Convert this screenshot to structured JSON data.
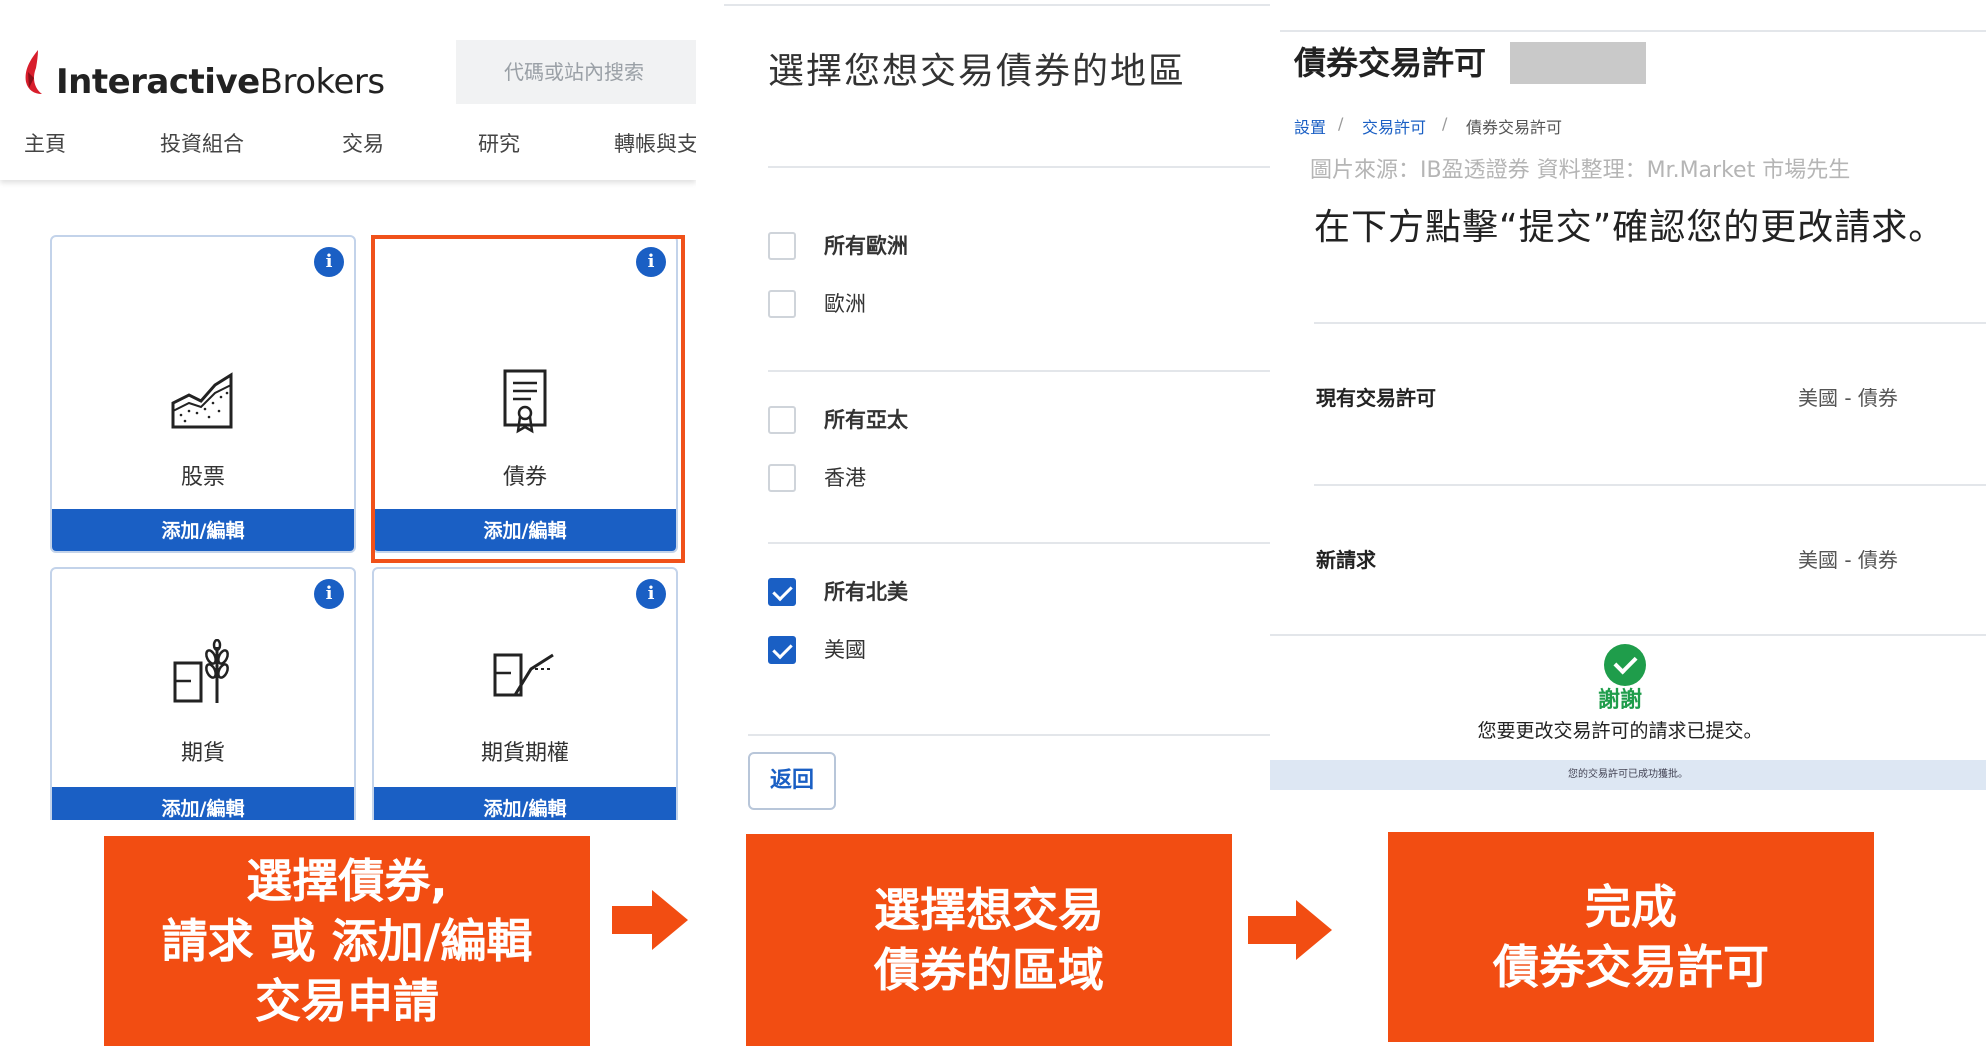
{
  "panel1": {
    "brand": {
      "bold": "Interactive",
      "regular": "Brokers"
    },
    "search": {
      "placeholder": "代碼或站內搜索"
    },
    "nav": [
      "主頁",
      "投資組合",
      "交易",
      "研究",
      "轉帳與支"
    ],
    "info_glyph": "i",
    "cards": [
      {
        "label": "股票",
        "button": "添加/編輯",
        "icon": "stock-chart-icon"
      },
      {
        "label": "債券",
        "button": "添加/編輯",
        "icon": "bond-certificate-icon"
      },
      {
        "label": "期貨",
        "button": "添加/編輯",
        "icon": "futures-wheat-icon"
      },
      {
        "label": "期貨期權",
        "button": "添加/編輯",
        "icon": "futures-options-icon"
      }
    ]
  },
  "panel2": {
    "title": "選擇您想交易債券的地區",
    "groups": [
      {
        "items": [
          {
            "label": "所有歐洲",
            "checked": false,
            "bold": true
          },
          {
            "label": "歐洲",
            "checked": false,
            "bold": false
          }
        ]
      },
      {
        "items": [
          {
            "label": "所有亞太",
            "checked": false,
            "bold": true
          },
          {
            "label": "香港",
            "checked": false,
            "bold": false
          }
        ]
      },
      {
        "items": [
          {
            "label": "所有北美",
            "checked": true,
            "bold": true
          },
          {
            "label": "美國",
            "checked": true,
            "bold": false
          }
        ]
      }
    ],
    "back_button": "返回"
  },
  "panel3": {
    "title": "債券交易許可",
    "breadcrumb": [
      "設置",
      "交易許可",
      "債券交易許可"
    ],
    "breadcrumb_sep": "/",
    "source_note": "圖片來源：IB盈透證券   資料整理：Mr.Market 市場先生",
    "confirm_text": "在下方點擊“提交”確認您的更改請求。",
    "rows": [
      {
        "label": "現有交易許可",
        "value": "美國 - 債券"
      },
      {
        "label": "新請求",
        "value": "美國 - 債券"
      }
    ],
    "thanks": "謝謝",
    "submitted": "您要更改交易許可的請求已提交。",
    "note": "您的交易許可已成功獲批。"
  },
  "steps": [
    {
      "lines": [
        "選擇債券,",
        "請求 或 添加/編輯",
        "交易申請"
      ]
    },
    {
      "lines": [
        "選擇想交易",
        "債券的區域"
      ]
    },
    {
      "lines": [
        "完成",
        "債券交易許可"
      ]
    }
  ],
  "colors": {
    "accent_blue": "#1a5fc4",
    "step_orange": "#f24d12",
    "success_green": "#1f9d4b"
  }
}
